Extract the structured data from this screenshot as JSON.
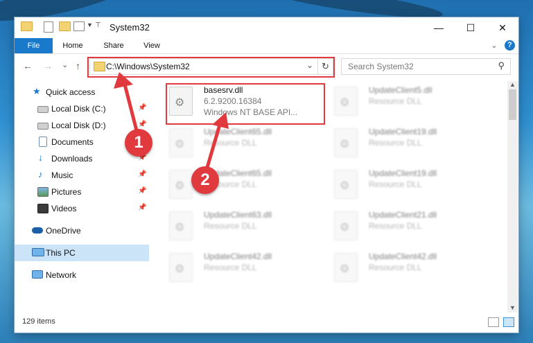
{
  "window": {
    "title": "System32",
    "minimize_glyph": "—",
    "maximize_glyph": "☐",
    "close_glyph": "✕"
  },
  "ribbon": {
    "tabs": [
      "File",
      "Home",
      "Share",
      "View"
    ],
    "expand_glyph": "⌄",
    "help_glyph": "?"
  },
  "navigation": {
    "back": "←",
    "forward": "→",
    "recent": "⌄",
    "up": "↑",
    "address": "C:\\Windows\\System32",
    "address_dropdown": "⌄",
    "refresh": "↻",
    "search_placeholder": "Search System32",
    "search_icon": "⚲"
  },
  "sidebar": {
    "items": [
      {
        "label": "Quick access",
        "icon": "star-icon",
        "pinned": false
      },
      {
        "label": "Local Disk (C:)",
        "icon": "drive-icon",
        "pinned": true
      },
      {
        "label": "Local Disk (D:)",
        "icon": "drive-icon",
        "pinned": true
      },
      {
        "label": "Documents",
        "icon": "documents-icon",
        "pinned": true
      },
      {
        "label": "Downloads",
        "icon": "download-icon",
        "pinned": true
      },
      {
        "label": "Music",
        "icon": "music-icon",
        "pinned": true
      },
      {
        "label": "Pictures",
        "icon": "pictures-icon",
        "pinned": true
      },
      {
        "label": "Videos",
        "icon": "videos-icon",
        "pinned": true
      },
      {
        "label": "OneDrive",
        "icon": "cloud-icon",
        "pinned": false
      },
      {
        "label": "This PC",
        "icon": "computer-icon",
        "pinned": false,
        "selected": true
      },
      {
        "label": "Network",
        "icon": "network-icon",
        "pinned": false
      }
    ]
  },
  "files": [
    {
      "name": "basesrv.dll",
      "version": "6.2.9200.16384",
      "description": "Windows NT BASE API...",
      "highlighted": true
    },
    {
      "name": "UpdateClient5.dll",
      "version": "Resource DLL"
    },
    {
      "name": "UpdateClient65.dll",
      "version": "Resource DLL"
    },
    {
      "name": "UpdateClient19.dll",
      "version": "Resource DLL"
    },
    {
      "name": "UpdateClient65.dll",
      "version": "Resource DLL"
    },
    {
      "name": "UpdateClient19.dll",
      "version": "Resource DLL"
    },
    {
      "name": "UpdateClient63.dll",
      "version": "Resource DLL"
    },
    {
      "name": "UpdateClient21.dll",
      "version": "Resource DLL"
    },
    {
      "name": "UpdateClient42.dll",
      "version": "Resource DLL"
    },
    {
      "name": "UpdateClient42.dll",
      "version": "Resource DLL"
    }
  ],
  "status": {
    "item_count": "129 items"
  },
  "annotations": {
    "badge1": "1",
    "badge2": "2",
    "accent_color": "#e0393e"
  },
  "colors": {
    "file_tab": "#1979ca",
    "selection": "#cce4f7"
  }
}
